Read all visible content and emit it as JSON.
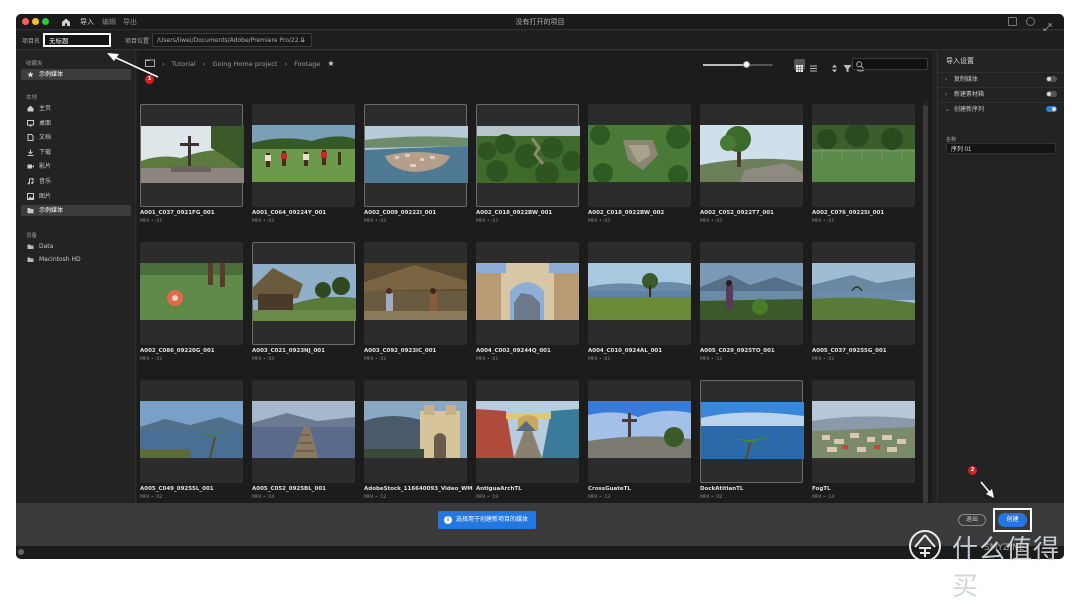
{
  "window": {
    "title": "没有打开的项目",
    "menus": [
      "导入",
      "编辑",
      "导出"
    ],
    "active_menu": "导入"
  },
  "toolbar": {
    "project_name_label": "项目名",
    "project_name_value": "无标题",
    "project_location_label": "项目位置",
    "project_location_value": "/Users/liwei/Documents/Adobe/Premiere Pro/22.0"
  },
  "sidebar": {
    "sections": [
      {
        "header": "收藏夹",
        "items": [
          {
            "label": "示例媒体",
            "icon": "star-icon",
            "selected": true
          }
        ]
      },
      {
        "header": "本地",
        "items": [
          {
            "label": "主页",
            "icon": "home-icon"
          },
          {
            "label": "桌面",
            "icon": "desktop-icon"
          },
          {
            "label": "文档",
            "icon": "document-icon"
          },
          {
            "label": "下载",
            "icon": "download-icon"
          },
          {
            "label": "影片",
            "icon": "video-icon"
          },
          {
            "label": "音乐",
            "icon": "music-icon"
          },
          {
            "label": "图片",
            "icon": "picture-icon"
          },
          {
            "label": "示例媒体",
            "icon": "folder-icon",
            "selected": true
          }
        ]
      },
      {
        "header": "设备",
        "items": [
          {
            "label": "Data",
            "icon": "drive-icon"
          },
          {
            "label": "Macintosh HD",
            "icon": "drive-icon"
          }
        ]
      }
    ]
  },
  "breadcrumb": [
    "Tutorial",
    "Going Home project",
    "Footage"
  ],
  "zoom_level": 0.62,
  "media": [
    {
      "name": "A001_C037_0921FG_001",
      "meta": "MP4 • :01",
      "scene": "cross"
    },
    {
      "name": "A001_C064_09224Y_001",
      "meta": "MP4 • :02",
      "scene": "soccer"
    },
    {
      "name": "A002_C009_09222I_001",
      "meta": "MP4 • :02",
      "scene": "aerialcity"
    },
    {
      "name": "A002_C018_0922BW_001",
      "meta": "MP4 • :07",
      "scene": "forest"
    },
    {
      "name": "A002_C018_0922BW_002",
      "meta": "MP4 • :03",
      "scene": "ruins"
    },
    {
      "name": "A002_C052_0922T7_001",
      "meta": "MP4 • :03",
      "scene": "tree"
    },
    {
      "name": "A002_C076_09225I_001",
      "meta": "MP4 • :01",
      "scene": "field"
    },
    {
      "name": "A002_C086_09220G_001",
      "meta": "MP4 • :02",
      "scene": "ball"
    },
    {
      "name": "A003_C021_0923NJ_001",
      "meta": "MP4 • :04",
      "scene": "hut"
    },
    {
      "name": "A003_C092_0923IC_001",
      "meta": "MP4 • :02",
      "scene": "hutpeople"
    },
    {
      "name": "A004_C002_09244Q_001",
      "meta": "MP4 • :01",
      "scene": "arch"
    },
    {
      "name": "A004_C010_0924AL_001",
      "meta": "MP4 • :01",
      "scene": "lakefield"
    },
    {
      "name": "A005_C029_0925TO_001",
      "meta": "MP4 • :12",
      "scene": "lakeperson"
    },
    {
      "name": "A005_C037_09255G_001",
      "meta": "MP4 • :02",
      "scene": "lakecoast"
    },
    {
      "name": "A005_C049_09255L_001",
      "meta": "MP4 • :02",
      "scene": "lakepalm"
    },
    {
      "name": "A005_C052_0925BL_001",
      "meta": "MP4 • :04",
      "scene": "pier"
    },
    {
      "name": "AdobeStock_116640093_Video_WM",
      "meta": "MP4 • :12",
      "scene": "church"
    },
    {
      "name": "AntiguaArchTL",
      "meta": "MP4 • :19",
      "scene": "street"
    },
    {
      "name": "CrossGuateTL",
      "meta": "MP4 • :13",
      "scene": "crossblue"
    },
    {
      "name": "DockAtitlanTL",
      "meta": "MP4 • :02",
      "scene": "dockpalm"
    },
    {
      "name": "FogTL",
      "meta": "MP4 • :14",
      "scene": "fogcity"
    }
  ],
  "import_settings": {
    "title": "导入设置",
    "rows": [
      {
        "label": "复制媒体",
        "on": false
      },
      {
        "label": "新建素材箱",
        "on": false
      },
      {
        "label": "创建新序列",
        "on": true
      }
    ],
    "sequence_name_label": "名称",
    "sequence_name_value": "序列 01"
  },
  "footer": {
    "info_text": "选择用于创建新项目的媒体",
    "exit_label": "退出",
    "create_label": "创建"
  },
  "annotations": {
    "badge_1": "1",
    "badge_2": "2"
  },
  "watermark": {
    "main": "什么值得买",
    "sub": "SMYZ.NET"
  },
  "colors": {
    "accent": "#2477e0",
    "badge": "#d42020",
    "panel": "#232323"
  }
}
